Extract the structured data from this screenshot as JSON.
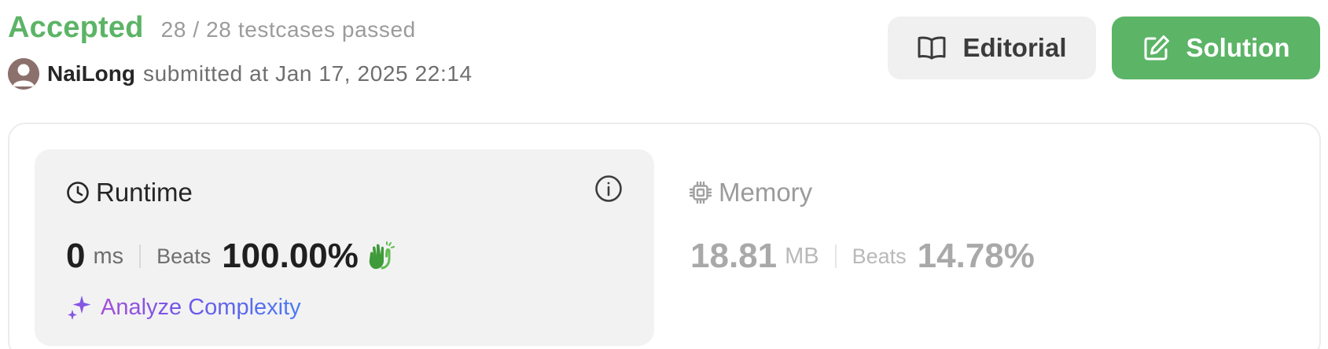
{
  "status": {
    "title": "Accepted",
    "passed_text": "28 / 28 testcases passed",
    "color": "#5cb466"
  },
  "submission": {
    "avatar_icon": "user-avatar-icon",
    "username": "NaiLong",
    "submitted_text": "submitted at Jan 17, 2025 22:14"
  },
  "buttons": {
    "editorial_label": "Editorial",
    "editorial_icon": "book-open-icon",
    "solution_label": "Solution",
    "solution_icon": "edit-pencil-icon",
    "solution_color": "#5cb466"
  },
  "runtime": {
    "title": "Runtime",
    "icon": "clock-icon",
    "info_icon": "info-circle-icon",
    "value": "0",
    "unit": "ms",
    "beats_label": "Beats",
    "beats_value": "100.00%",
    "badge_icon": "clapping-hands-icon",
    "analyze_label": "Analyze Complexity",
    "analyze_icon": "sparkle-icon"
  },
  "memory": {
    "title": "Memory",
    "icon": "chip-icon",
    "value": "18.81",
    "unit": "MB",
    "beats_label": "Beats",
    "beats_value": "14.78%"
  }
}
